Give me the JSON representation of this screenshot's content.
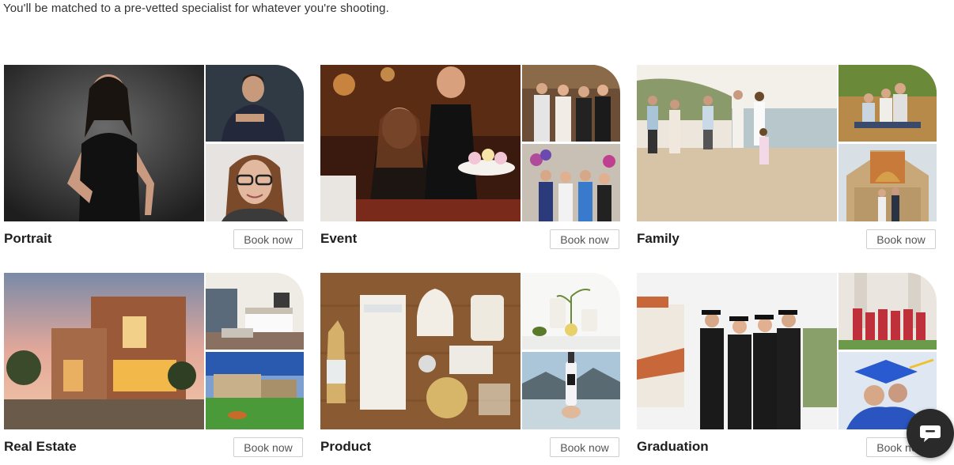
{
  "intro": "You'll be matched to a pre-vetted specialist for whatever you're shooting.",
  "categories": [
    {
      "label": "Portrait",
      "button": "Book now"
    },
    {
      "label": "Event",
      "button": "Book now"
    },
    {
      "label": "Family",
      "button": "Book now"
    },
    {
      "label": "Real Estate",
      "button": "Book now"
    },
    {
      "label": "Product",
      "button": "Book now"
    },
    {
      "label": "Graduation",
      "button": "Book now"
    }
  ],
  "chat": {
    "icon": "chat-bubble-icon"
  },
  "colors": {
    "text": "#1f1f1f",
    "button_border": "#cfcfcf",
    "chat_bg": "#2a2a2a"
  }
}
